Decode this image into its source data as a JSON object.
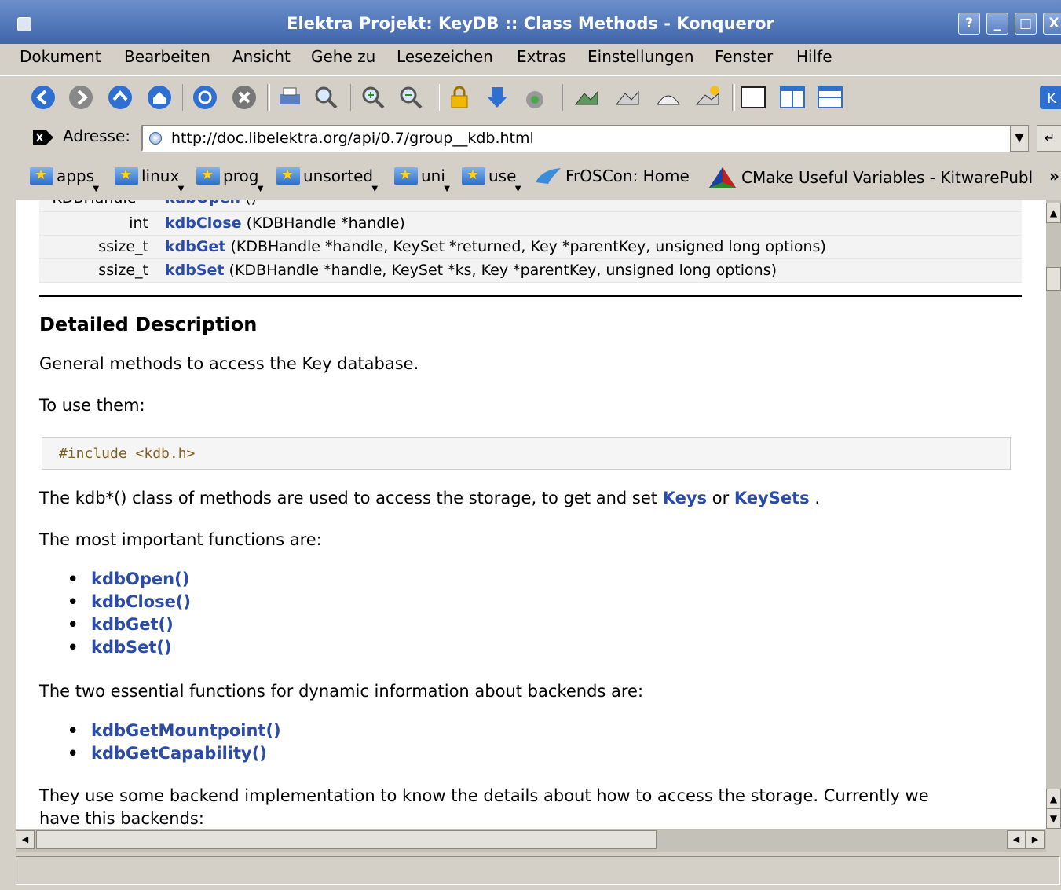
{
  "window": {
    "title": "Elektra Projekt: KeyDB :: Class Methods - Konqueror",
    "buttons": {
      "help": "?",
      "minimize": "_",
      "maximize": "□",
      "close": "X"
    }
  },
  "menu": [
    "Dokument",
    "Bearbeiten",
    "Ansicht",
    "Gehe zu",
    "Lesezeichen",
    "Extras",
    "Einstellungen",
    "Fenster",
    "Hilfe"
  ],
  "toolbar_icons": [
    "back-icon",
    "forward-icon",
    "up-icon",
    "home-icon",
    "reload-icon",
    "stop-icon",
    "print-icon",
    "find-icon",
    "zoom-in-icon",
    "zoom-out-icon",
    "security-icon",
    "download-icon",
    "plugin-icon",
    "kde-icon"
  ],
  "address": {
    "label": "Adresse:",
    "url": "http://doc.libelektra.org/api/0.7/group__kdb.html"
  },
  "bookmarks": [
    "apps",
    "linux",
    "prog",
    "unsorted",
    "uni",
    "use",
    "FrOSCon: Home",
    "CMake Useful Variables - KitwarePubl",
    "»"
  ],
  "members": [
    {
      "ret": "KDBHandle *",
      "name": "kdbOpen",
      "args": "()"
    },
    {
      "ret": "int",
      "name": "kdbClose",
      "args": "(KDBHandle *handle)"
    },
    {
      "ret": "ssize_t",
      "name": "kdbGet",
      "args": "(KDBHandle *handle, KeySet *returned, Key *parentKey, unsigned long options)"
    },
    {
      "ret": "ssize_t",
      "name": "kdbSet",
      "args": "(KDBHandle *handle, KeySet *ks, Key *parentKey, unsigned long options)"
    }
  ],
  "doc": {
    "heading": "Detailed Description",
    "p1": "General methods to access the Key database.",
    "p2": "To use them:",
    "code": "#include <kdb.h>",
    "p3_pre": "The kdb*() class of methods are used to access the storage, to get and set ",
    "p3_link1": "Keys",
    "p3_mid": " or ",
    "p3_link2": "KeySets",
    "p3_post": " .",
    "p4": "The most important functions are:",
    "list1": [
      "kdbOpen()",
      "kdbClose()",
      "kdbGet()",
      "kdbSet()"
    ],
    "p5": "The two essential functions for dynamic information about backends are:",
    "list2": [
      "kdbGetMountpoint()",
      "kdbGetCapability()"
    ],
    "p6_line1": "They use some backend implementation to know the details about how to access the storage. Currently we",
    "p6_line2": "have this backends:"
  }
}
